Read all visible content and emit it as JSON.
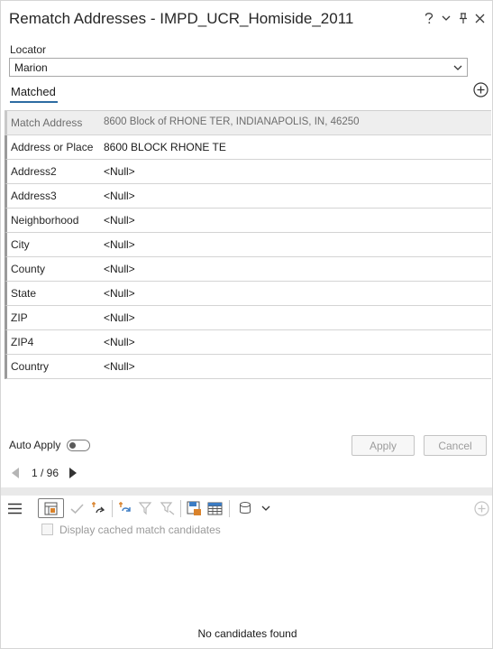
{
  "window": {
    "title": "Rematch Addresses - IMPD_UCR_Homiside_2011",
    "help_label": "?",
    "menu_label": "⌄",
    "pin_label": "📌",
    "close_label": "✕"
  },
  "locator": {
    "label": "Locator",
    "value": "Marion"
  },
  "tabs": [
    {
      "label": "Matched"
    }
  ],
  "fields": [
    {
      "key": "Match Address",
      "value": "8600 Block of RHONE TER, INDIANAPOLIS, IN, 46250"
    },
    {
      "key": "Address or Place",
      "value": "8600 BLOCK RHONE TE"
    },
    {
      "key": "Address2",
      "value": "<Null>"
    },
    {
      "key": "Address3",
      "value": "<Null>"
    },
    {
      "key": "Neighborhood",
      "value": "<Null>"
    },
    {
      "key": "City",
      "value": "<Null>"
    },
    {
      "key": "County",
      "value": "<Null>"
    },
    {
      "key": "State",
      "value": "<Null>"
    },
    {
      "key": "ZIP",
      "value": "<Null>"
    },
    {
      "key": "ZIP4",
      "value": "<Null>"
    },
    {
      "key": "Country",
      "value": "<Null>"
    }
  ],
  "auto_apply": {
    "label": "Auto Apply",
    "on": false
  },
  "buttons": {
    "apply": "Apply",
    "cancel": "Cancel"
  },
  "navigation": {
    "page_text": "1 / 96"
  },
  "candidates": {
    "cached_label": "Display cached match candidates",
    "empty_text": "No candidates found"
  },
  "colors": {
    "accent": "#2d6ca2",
    "brand_orange": "#d9822b",
    "brand_blue": "#3b7cc4"
  }
}
